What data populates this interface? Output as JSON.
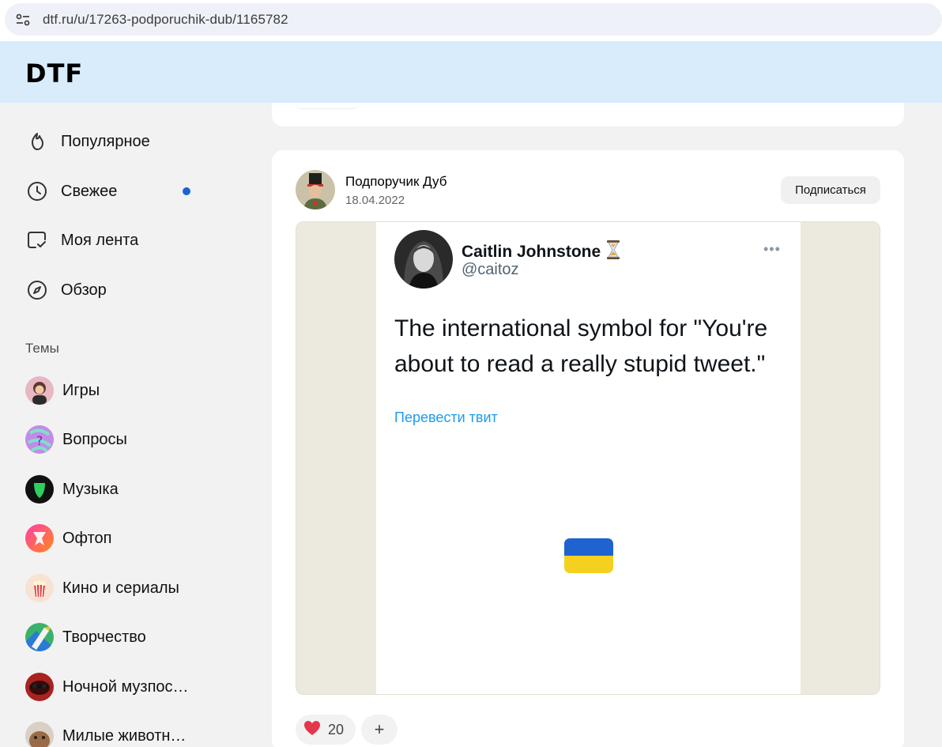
{
  "browser": {
    "url": "dtf.ru/u/17263-podporuchik-dub/1165782",
    "site_info_icon": "tune-icon"
  },
  "header": {
    "logo": "DTF"
  },
  "sidebar": {
    "nav": [
      {
        "label": "Популярное",
        "icon": "flame-icon"
      },
      {
        "label": "Свежее",
        "icon": "clock-icon",
        "has_dot": true,
        "dot_color": "#1a63d6"
      },
      {
        "label": "Моя лента",
        "icon": "feed-check-icon"
      },
      {
        "label": "Обзор",
        "icon": "compass-icon"
      }
    ],
    "themes_title": "Темы",
    "topics": [
      {
        "label": "Игры"
      },
      {
        "label": "Вопросы"
      },
      {
        "label": "Музыка"
      },
      {
        "label": "Офтоп"
      },
      {
        "label": "Кино и сериалы"
      },
      {
        "label": "Творчество"
      },
      {
        "label": "Ночной музпос…"
      },
      {
        "label": "Милые животн…"
      }
    ]
  },
  "post": {
    "author": "Подпоручик Дуб",
    "date": "18.04.2022",
    "subscribe_label": "Подписаться",
    "tweet": {
      "name": "Caitlin Johnstone",
      "name_emoji": "⏳",
      "handle": "@caitoz",
      "more": "•••",
      "text": "The international symbol for \"You're about to read a really stupid tweet.\"",
      "translate": "Перевести твит",
      "flag_colors": [
        "#1f63d1",
        "#f5d11f"
      ]
    },
    "reactions": {
      "count": "20",
      "add": "+",
      "heart_color": "#e5364b"
    }
  },
  "colors": {
    "header_bg": "#d8ecfb",
    "page_bg": "#f2f2f2",
    "accent_dot": "#1a63d6",
    "tweet_link": "#1d9bf0"
  }
}
